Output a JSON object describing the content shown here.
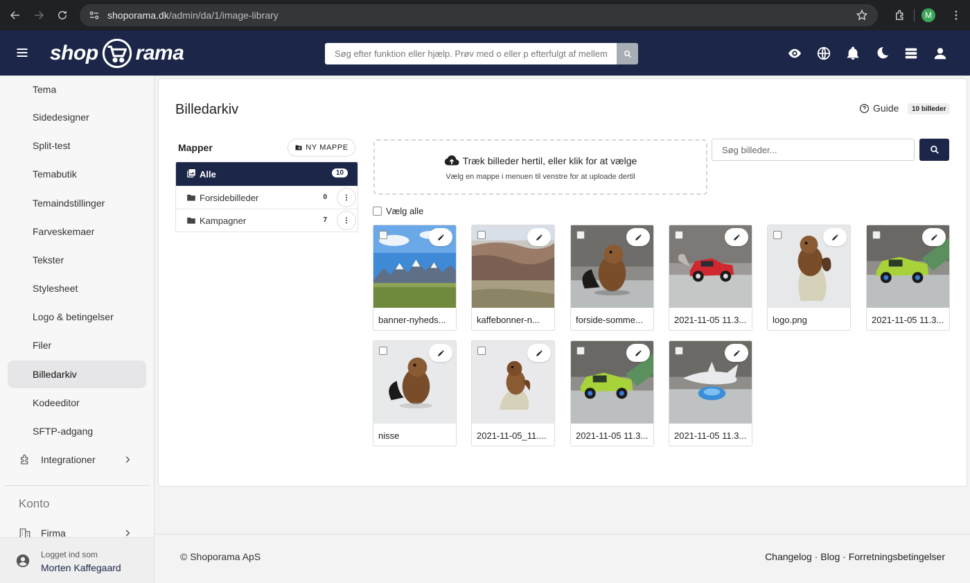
{
  "browser": {
    "url_host": "shoporama.dk",
    "url_path": "/admin/da/1/image-library",
    "profile_initial": "M"
  },
  "header": {
    "logo_left": "shop",
    "logo_right": "rama",
    "search_placeholder": "Søg efter funktion eller hjælp. Prøv med o eller p efterfulgt af mellemrum"
  },
  "sidebar": {
    "items": [
      {
        "label": "Tema"
      },
      {
        "label": "Sidedesigner"
      },
      {
        "label": "Split-test"
      },
      {
        "label": "Temabutik"
      },
      {
        "label": "Temaindstillinger"
      },
      {
        "label": "Farveskemaer"
      },
      {
        "label": "Tekster"
      },
      {
        "label": "Stylesheet"
      },
      {
        "label": "Logo & betingelser"
      },
      {
        "label": "Filer"
      },
      {
        "label": "Billedarkiv"
      },
      {
        "label": "Kodeeditor"
      },
      {
        "label": "SFTP-adgang"
      },
      {
        "label": "Integrationer"
      }
    ],
    "section_label": "Konto",
    "company_label": "Firma",
    "logged_in_label": "Logget ind som",
    "user_name": "Morten Kaffegaard"
  },
  "main": {
    "title": "Billedarkiv",
    "guide_label": "Guide",
    "count_badge": "10 billeder",
    "folders_title": "Mapper",
    "new_folder_label": "NY MAPPE",
    "folders": [
      {
        "name": "Alle",
        "count": "10"
      },
      {
        "name": "Forsidebilleder",
        "count": "0"
      },
      {
        "name": "Kampagner",
        "count": "7"
      }
    ],
    "dropzone_title": "Træk billeder hertil, eller klik for at vælge",
    "dropzone_sub": "Vælg en mappe i menuen til venstre for at uploade dertil",
    "image_search_placeholder": "Søg billeder...",
    "select_all_label": "Vælg alle",
    "images": [
      {
        "name": "banner-nyheds...",
        "kind": "mountains"
      },
      {
        "name": "kaffebonner-n...",
        "kind": "canyon"
      },
      {
        "name": "forside-somme...",
        "kind": "beaver"
      },
      {
        "name": "2021-11-05 11.3...",
        "kind": "redcar"
      },
      {
        "name": "logo.png",
        "kind": "beaver-gray"
      },
      {
        "name": "2021-11-05 11.3...",
        "kind": "greencar"
      },
      {
        "name": "nisse",
        "kind": "beaver-white"
      },
      {
        "name": "2021-11-05_11....",
        "kind": "monkey"
      },
      {
        "name": "2021-11-05 11.3...",
        "kind": "greencar"
      },
      {
        "name": "2021-11-05 11.3...",
        "kind": "shark"
      }
    ]
  },
  "footer": {
    "copyright": "© Shoporama ApS",
    "links": "Changelog · Blog · Forretningsbetingelser"
  }
}
